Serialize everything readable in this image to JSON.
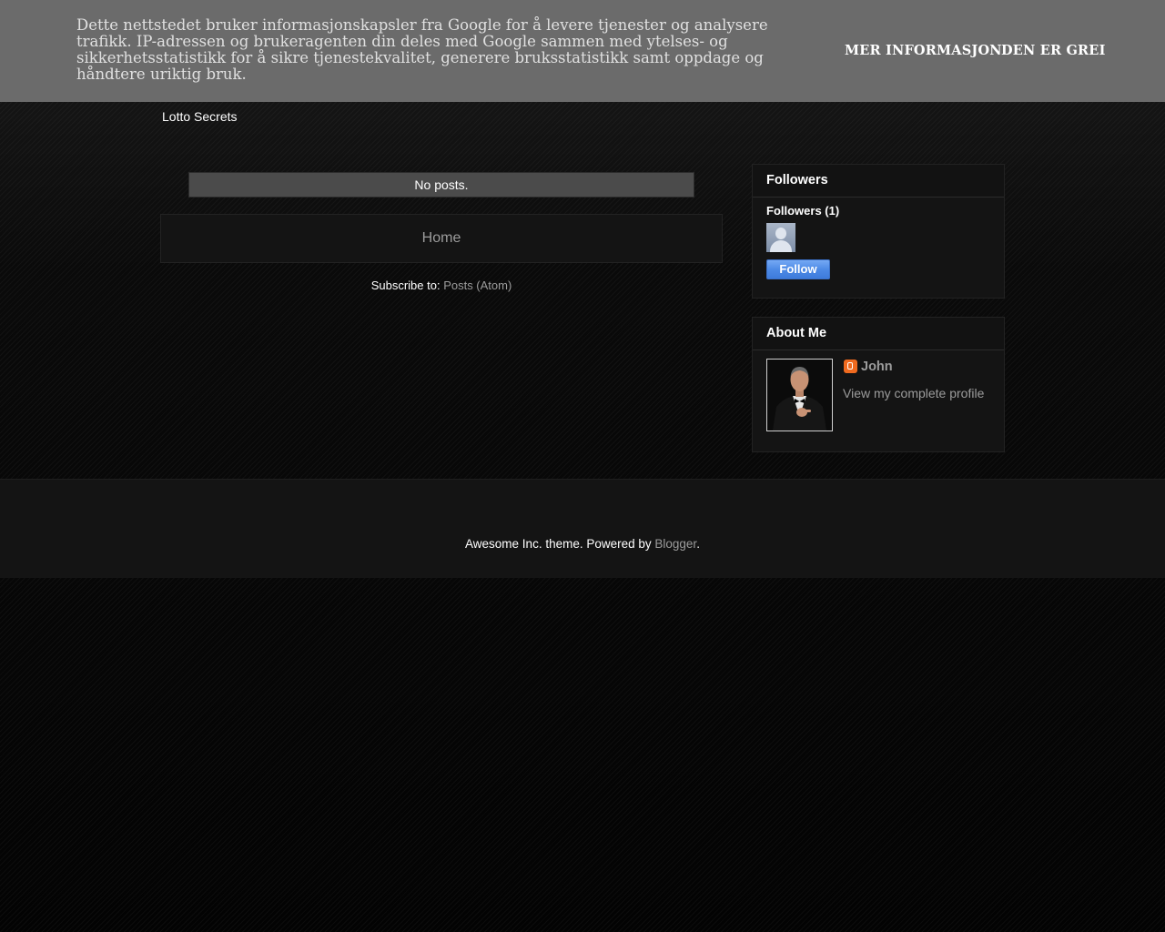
{
  "cookie_banner": {
    "message": "Dette nettstedet bruker informasjonskapsler fra Google for å levere tjenester og analysere trafikk. IP-adressen og brukeragenten din deles med Google sammen med ytelses- og sikkerhetsstatistikk for å sikre tjenestekvalitet, generere bruksstatistikk samt oppdage og håndtere uriktig bruk.",
    "more_info_label": "MER INFORMASJON",
    "accept_label": "DEN ER GREI"
  },
  "header": {
    "blog_title": "Lotto Secrets"
  },
  "main": {
    "no_posts_text": "No posts.",
    "home_link": "Home",
    "subscribe_prefix": "Subscribe to: ",
    "subscribe_link": "Posts (Atom)"
  },
  "sidebar": {
    "followers": {
      "title": "Followers",
      "count_label": "Followers (1)",
      "follow_button": "Follow"
    },
    "about_me": {
      "title": "About Me",
      "name": "John",
      "view_profile": "View my complete profile"
    }
  },
  "footer": {
    "text_prefix": "Awesome Inc. theme. Powered by ",
    "powered_link": "Blogger",
    "text_suffix": "."
  },
  "colors": {
    "banner_bg": "#6b6b6b",
    "link": "#9c9c9c",
    "widget_bg": "#141414",
    "follow_button": "#4d8ae6",
    "blogger_orange": "#f06a1f"
  }
}
